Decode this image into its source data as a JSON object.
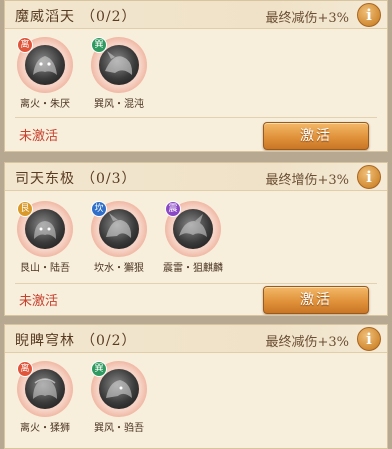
{
  "cards": [
    {
      "title": "魔威滔天",
      "count": "（0/2）",
      "bonus": "最终减伤+3%",
      "status": "未激活",
      "button": "激活",
      "creatures": [
        {
          "name": "离火・朱厌",
          "element": "离",
          "color": "#e0553a"
        },
        {
          "name": "巽风・混沌",
          "element": "巽",
          "color": "#2f9a5f"
        }
      ]
    },
    {
      "title": "司天东极",
      "count": "（0/3）",
      "bonus": "最终增伤+3%",
      "status": "未激活",
      "button": "激活",
      "creatures": [
        {
          "name": "艮山・陆吾",
          "element": "艮",
          "color": "#d99a2a"
        },
        {
          "name": "坎水・獬狠",
          "element": "坎",
          "color": "#2f6fc9"
        },
        {
          "name": "震雷・狙麒麟",
          "element": "震",
          "color": "#8a48c6"
        }
      ]
    },
    {
      "title": "睨睥穹林",
      "count": "（0/2）",
      "bonus": "最终减伤+3%",
      "creatures": [
        {
          "name": "离火・猱狮",
          "element": "离",
          "color": "#e0553a"
        },
        {
          "name": "巽风・驺吾",
          "element": "巽",
          "color": "#2f9a5f"
        }
      ]
    }
  ],
  "info_icon": "i"
}
